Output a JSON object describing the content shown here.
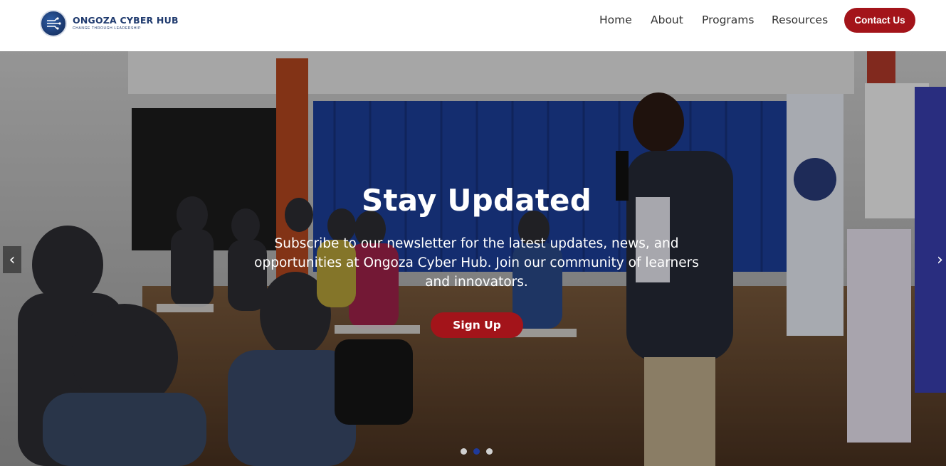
{
  "brand": {
    "name": "ONGOZA CYBER HUB",
    "tagline": "CHANGE THROUGH LEADERSHIP",
    "logo_icon": "circuit-logo-icon",
    "color": "#1f3a6e"
  },
  "nav": {
    "items": [
      {
        "label": "Home"
      },
      {
        "label": "About"
      },
      {
        "label": "Programs"
      },
      {
        "label": "Resources"
      }
    ],
    "contact_label": "Contact Us",
    "accent": "#a3141a"
  },
  "hero": {
    "title": "Stay Updated",
    "text": "Subscribe to our newsletter for the latest updates, news, and opportunities at Ongoza Cyber Hub. Join our community of learners and innovators.",
    "button_label": "Sign Up",
    "prev_label": "‹",
    "next_label": "›",
    "slides_total": 3,
    "active_slide": 2
  }
}
